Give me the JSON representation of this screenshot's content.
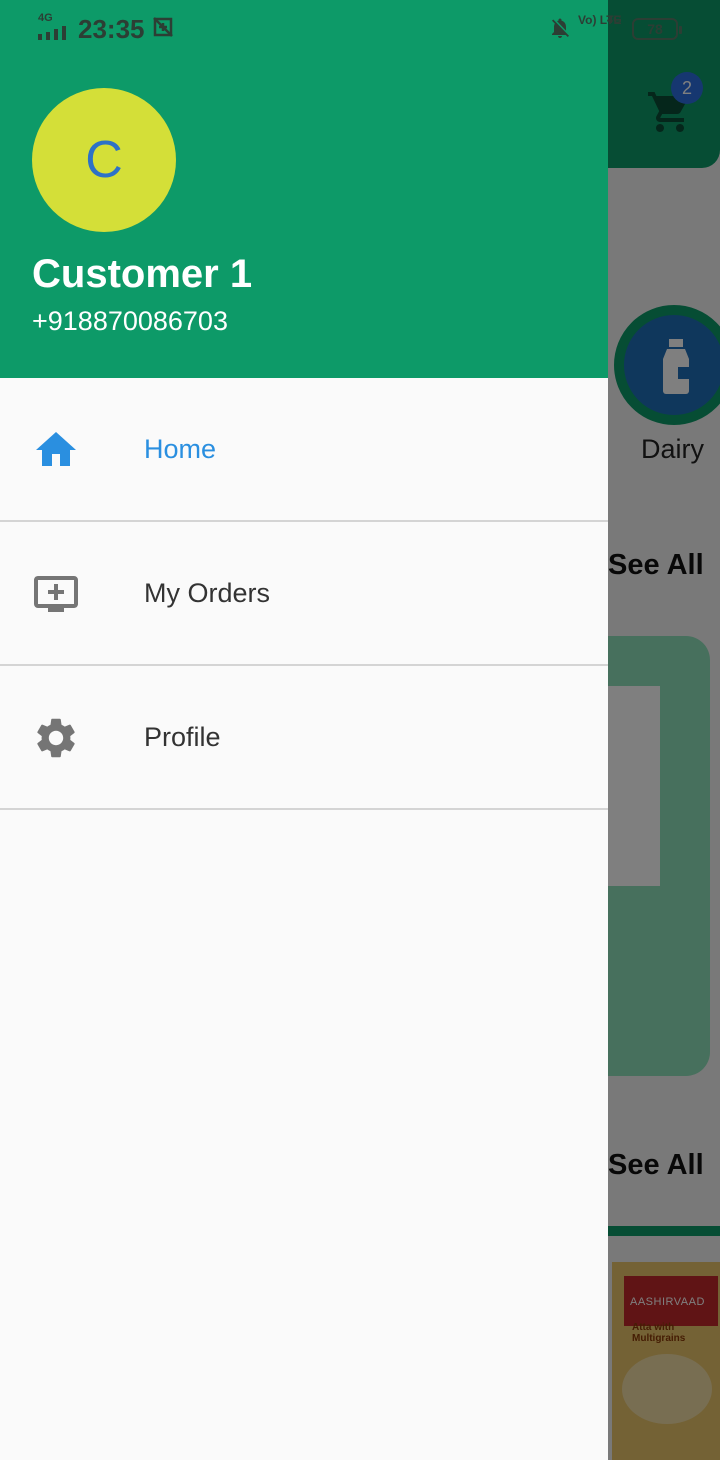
{
  "status_bar": {
    "network_label": "4G",
    "time": "23:35",
    "volte_label": "Vo) LTE",
    "network_label_2": "4G",
    "battery_level": "78"
  },
  "background": {
    "cart_badge_count": "2",
    "category_label": "Dairy",
    "see_all_label_1": "See All",
    "see_all_label_2": "See All",
    "product_brand": "AASHIRVAAD",
    "product_subtitle": "Atta with Multigrains"
  },
  "drawer": {
    "avatar_initial": "C",
    "user_name": "Customer 1",
    "user_phone": "+918870086703",
    "menu": [
      {
        "label": "Home",
        "icon": "home-icon",
        "active": true
      },
      {
        "label": "My Orders",
        "icon": "monitor-plus-icon",
        "active": false
      },
      {
        "label": "Profile",
        "icon": "gear-icon",
        "active": false
      }
    ]
  },
  "colors": {
    "primary_green": "#0d9a68",
    "avatar_bg": "#d4df38",
    "active_blue": "#2a8fe0",
    "icon_grey": "#757575",
    "badge_blue": "#2d6fe0"
  }
}
